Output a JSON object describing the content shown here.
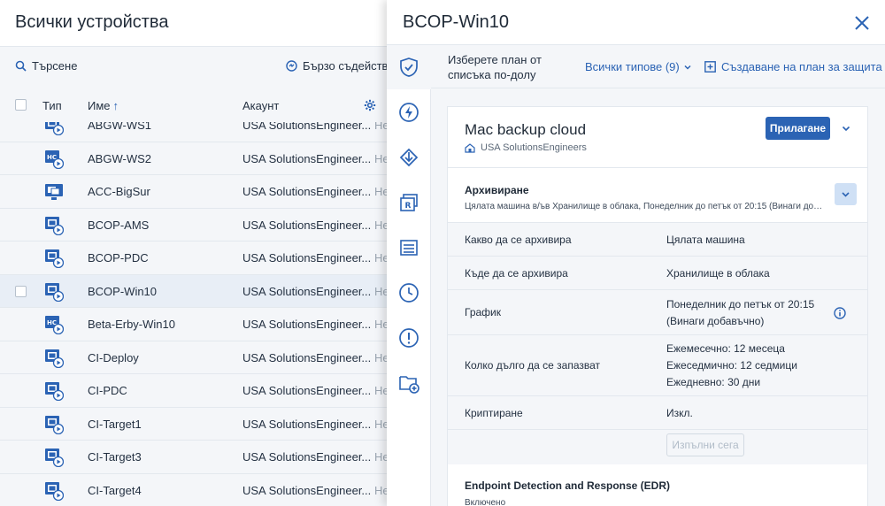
{
  "list": {
    "title": "Всички устройства",
    "search_label": "Търсене",
    "quick_label": "Бързо съдействие",
    "columns": {
      "type": "Тип",
      "name": "Име",
      "account": "Акаунт"
    },
    "rows": [
      {
        "name": "ABGW-WS1",
        "account": "USA SolutionsEngineer...",
        "status": "Не",
        "icon": "windows-device-icon"
      },
      {
        "name": "ABGW-WS2",
        "account": "USA SolutionsEngineer...",
        "status": "Не",
        "icon": "hci-device-icon"
      },
      {
        "name": "ACC-BigSur",
        "account": "USA SolutionsEngineer...",
        "status": "Не",
        "icon": "mac-device-icon"
      },
      {
        "name": "BCOP-AMS",
        "account": "USA SolutionsEngineer...",
        "status": "Не",
        "icon": "windows-device-icon"
      },
      {
        "name": "BCOP-PDC",
        "account": "USA SolutionsEngineer...",
        "status": "Не",
        "icon": "windows-device-icon"
      },
      {
        "name": "BCOP-Win10",
        "account": "USA SolutionsEngineer...",
        "status": "Не",
        "icon": "windows-device-icon"
      },
      {
        "name": "Beta-Erby-Win10",
        "account": "USA SolutionsEngineer...",
        "status": "Не",
        "icon": "hci-device-icon"
      },
      {
        "name": "CI-Deploy",
        "account": "USA SolutionsEngineer...",
        "status": "Не",
        "icon": "windows-device-icon"
      },
      {
        "name": "CI-PDC",
        "account": "USA SolutionsEngineer...",
        "status": "Не",
        "icon": "windows-device-icon"
      },
      {
        "name": "CI-Target1",
        "account": "USA SolutionsEngineer...",
        "status": "Не",
        "icon": "windows-device-icon"
      },
      {
        "name": "CI-Target3",
        "account": "USA SolutionsEngineer...",
        "status": "Не",
        "icon": "windows-device-icon"
      },
      {
        "name": "CI-Target4",
        "account": "USA SolutionsEngineer...",
        "status": "Не",
        "icon": "windows-device-icon"
      }
    ],
    "selected_row": "BCOP-Win10"
  },
  "panel": {
    "title": "BCOP-Win10",
    "subbar_text": "Изберете план от списъка по-долу",
    "filter_label": "Всички типове (9)",
    "create_label": "Създаване на план за защита",
    "plan": {
      "name": "Mac backup cloud",
      "owner": "USA SolutionsEngineers",
      "apply_label": "Прилагане",
      "section_title": "Архивиране",
      "section_summary": "Цялата машина в/ъв Хранилище в облака, Понеделник до петък от 20:15 (Винаги доб...",
      "details": [
        {
          "label": "Какво да се архивира",
          "value": "Цялата машина"
        },
        {
          "label": "Къде да се архивира",
          "value": "Хранилище в облака"
        },
        {
          "label": "График",
          "value_lines": [
            "Понеделник до петък от 20:15",
            "(Винаги добавъчно)"
          ]
        },
        {
          "label": "Колко дълго да се запазват",
          "value_lines": [
            "Ежемесечно: 12 месеца",
            "Ежеседмично: 12 седмици",
            "Ежедневно: 30 дни"
          ]
        },
        {
          "label": "Криптиране",
          "value": "Изкл."
        }
      ],
      "run_label": "Изпълни сега",
      "edr_title": "Endpoint Detection and Response (EDR)",
      "edr_status": "Включено"
    }
  },
  "colors": {
    "accent": "#2b63b4",
    "panel_bg": "#f4f6f9",
    "selected_row": "#e8eef6"
  }
}
